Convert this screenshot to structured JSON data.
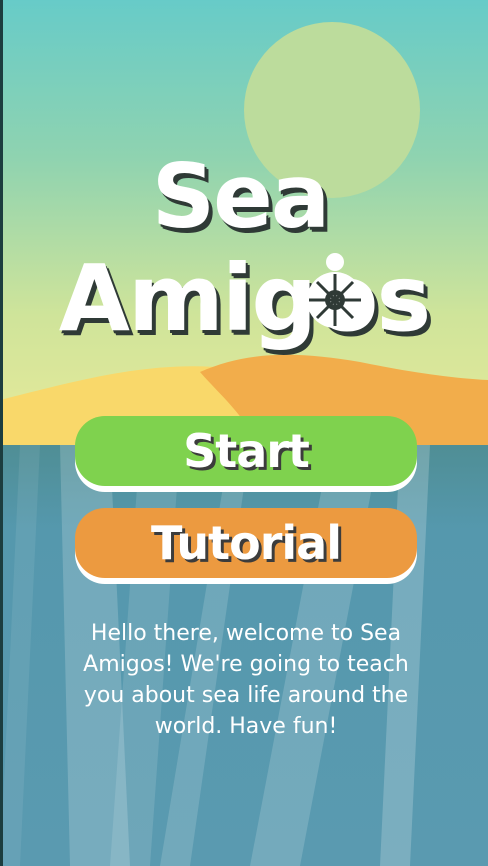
{
  "title": {
    "line1": "Sea",
    "line2": "Amigos"
  },
  "buttons": {
    "start_label": "Start",
    "tutorial_label": "Tutorial"
  },
  "intro_text": "Hello there, welcome to Sea Amigos! We're going to teach you about sea life around the world. Have fun!",
  "colors": {
    "start_button": "#7fd24e",
    "tutorial_button": "#ec9a40",
    "sand_light": "#f9d86a",
    "sand_dark": "#f2ad4b",
    "sea": "#5a9ab0",
    "sun": "#bcdc9c"
  },
  "icons": [
    "turtle-icon"
  ]
}
